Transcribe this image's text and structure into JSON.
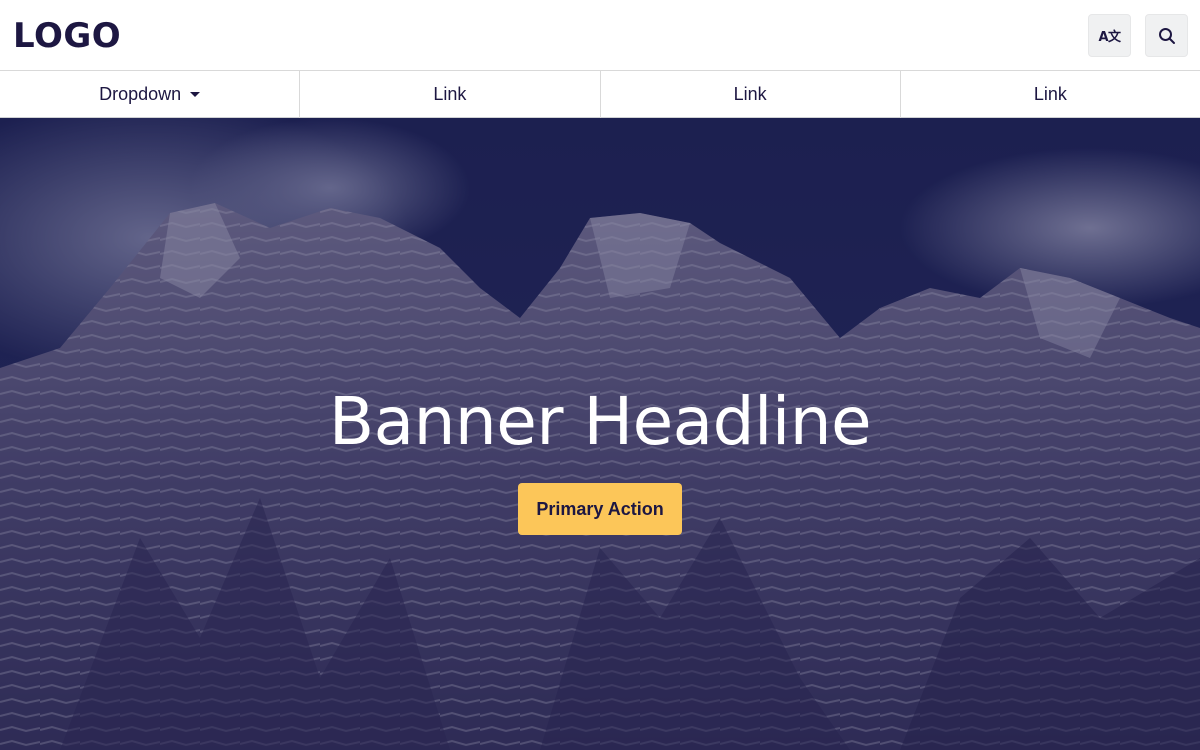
{
  "header": {
    "logo_text": "LOGO",
    "translate_icon_glyph": "A文",
    "translate_icon": "translate-icon",
    "search_icon": "search-icon"
  },
  "nav": {
    "items": [
      {
        "label": "Dropdown",
        "has_caret": true
      },
      {
        "label": "Link"
      },
      {
        "label": "Link"
      },
      {
        "label": "Link"
      }
    ]
  },
  "hero": {
    "headline": "Banner Headline",
    "primary_action": "Primary Action"
  },
  "colors": {
    "brand_navy": "#1d1742",
    "accent_yellow": "#fcc659",
    "nav_border": "#d9d9d9",
    "icon_bg": "#f0f1f2"
  }
}
